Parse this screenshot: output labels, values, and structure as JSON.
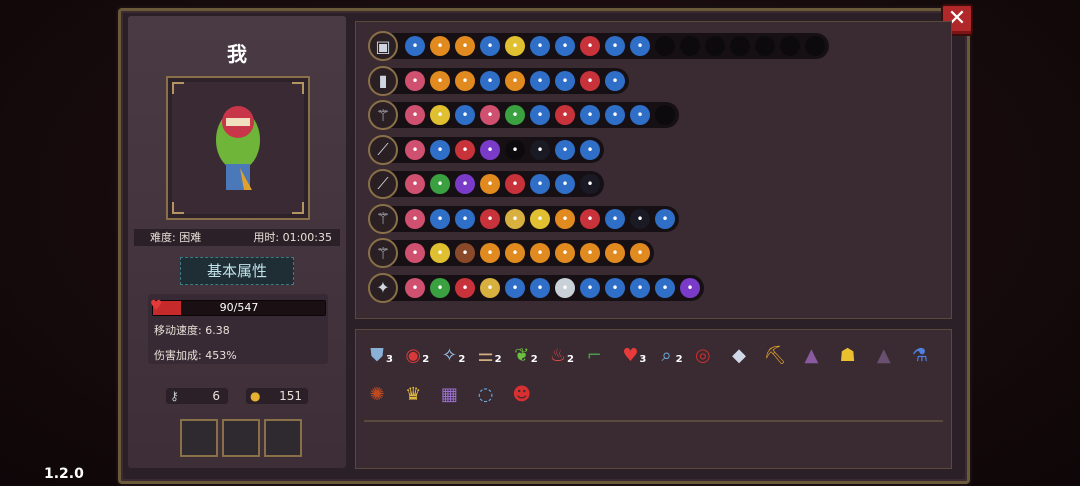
{
  "character": {
    "name": "我",
    "difficulty": "难度: 困难",
    "time": "用时: 01:00:35"
  },
  "tab": "基本属性",
  "stats": {
    "hp_text": "90/547",
    "hp_fraction": 0.165,
    "move_speed": "移动速度: 6.38",
    "damage_bonus": "伤害加成: 453%"
  },
  "resources": {
    "keys": "6",
    "coins": "151"
  },
  "version": "1.2.0",
  "colors": {
    "accent": "#c72a2a",
    "frame": "#6b5a3a",
    "panel": "#3a2a32"
  },
  "icons": {
    "close": "close-x-icon",
    "heart": "heart-icon",
    "key": "key-icon",
    "coin": "coin-icon"
  },
  "weapon_rows": [
    {
      "weapon": "chest-icon",
      "slots": 17,
      "filled": [
        "blue",
        "orange",
        "orange",
        "blue",
        "yellow",
        "blue",
        "blue",
        "red",
        "blue",
        "blue"
      ]
    },
    {
      "weapon": "cannon-icon",
      "slots": 9,
      "filled": [
        "pink",
        "orange",
        "orange",
        "blue",
        "orange",
        "blue",
        "blue",
        "red",
        "blue"
      ]
    },
    {
      "weapon": "staff-icon",
      "slots": 11,
      "filled": [
        "pink",
        "yellow",
        "blue",
        "pink",
        "green",
        "blue",
        "red",
        "blue",
        "blue",
        "blue"
      ]
    },
    {
      "weapon": "blade-icon",
      "slots": 8,
      "filled": [
        "pink",
        "blue",
        "red",
        "purple",
        "empty",
        "dark",
        "blue",
        "blue"
      ]
    },
    {
      "weapon": "rod-green-icon",
      "slots": 8,
      "filled": [
        "pink",
        "green",
        "purple",
        "orange",
        "red",
        "blue",
        "blue",
        "dark"
      ]
    },
    {
      "weapon": "rod-gold-icon",
      "slots": 11,
      "filled": [
        "pink",
        "blue",
        "blue",
        "red",
        "gold",
        "yellow",
        "orange",
        "red",
        "blue",
        "dark",
        "blue"
      ]
    },
    {
      "weapon": "rod-orange-icon",
      "slots": 10,
      "filled": [
        "pink",
        "yellow",
        "brown",
        "orange",
        "orange",
        "orange",
        "orange",
        "orange",
        "orange",
        "orange"
      ]
    },
    {
      "weapon": "wand-purple-icon",
      "slots": 12,
      "filled": [
        "pink",
        "green",
        "red",
        "gold",
        "blue",
        "blue",
        "white",
        "blue",
        "blue",
        "blue",
        "blue",
        "purple"
      ]
    }
  ],
  "inventory": [
    {
      "icon": "shield-icon",
      "count": "3"
    },
    {
      "icon": "red-eye-icon",
      "count": "2"
    },
    {
      "icon": "wing-icon",
      "count": "2"
    },
    {
      "icon": "bone-icon",
      "count": "2"
    },
    {
      "icon": "leaf-icon",
      "count": "2"
    },
    {
      "icon": "potion-red-icon",
      "count": "2"
    },
    {
      "icon": "boot-icon",
      "count": ""
    },
    {
      "icon": "heart-icon",
      "count": "3"
    },
    {
      "icon": "magnifier-icon",
      "count": "2"
    },
    {
      "icon": "eye-icon",
      "count": ""
    },
    {
      "icon": "crystal-icon",
      "count": ""
    },
    {
      "icon": "pickaxe-icon",
      "count": ""
    },
    {
      "icon": "cape-icon",
      "count": ""
    },
    {
      "icon": "bell-icon",
      "count": ""
    },
    {
      "icon": "cloak-icon",
      "count": ""
    },
    {
      "icon": "vial-icon",
      "count": ""
    },
    {
      "icon": "rune-icon",
      "count": ""
    },
    {
      "icon": "crown-icon",
      "count": ""
    },
    {
      "icon": "scroll-icon",
      "count": ""
    },
    {
      "icon": "ring-icon",
      "count": ""
    },
    {
      "icon": "demon-mask-icon",
      "count": ""
    }
  ]
}
